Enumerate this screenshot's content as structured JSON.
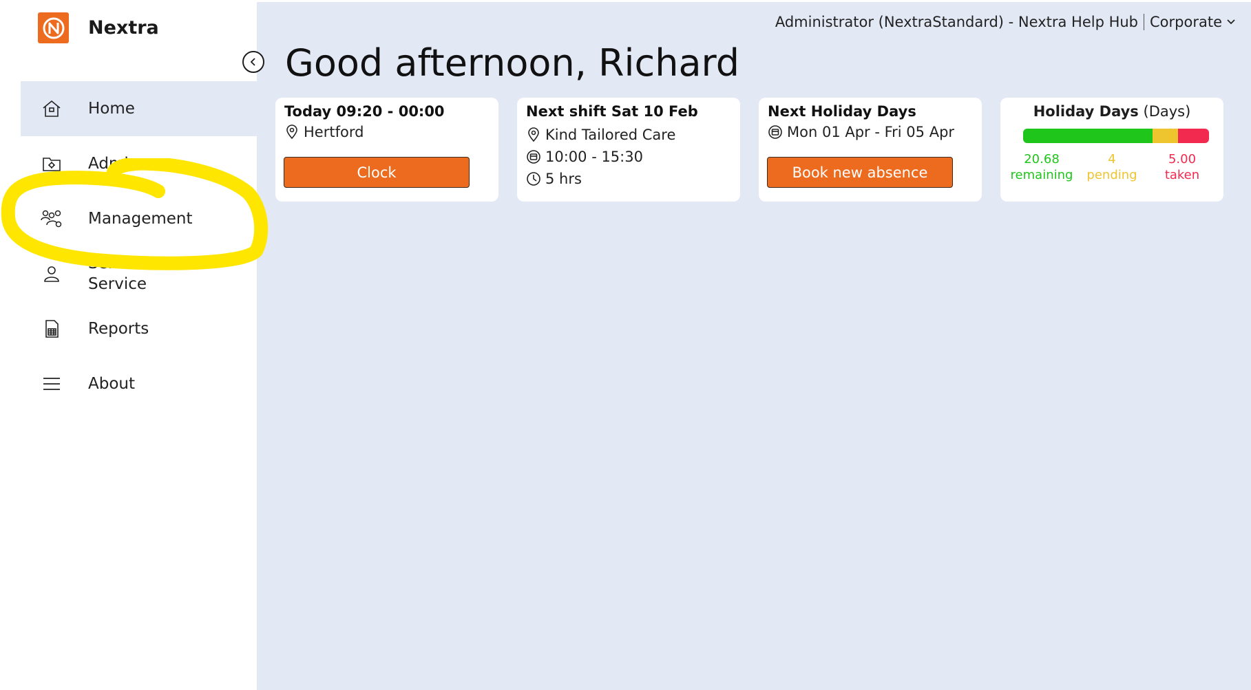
{
  "app": {
    "name": "Nextra",
    "logo_icon": "nextra-logo-icon",
    "brand_color": "#ec6b1e"
  },
  "header": {
    "user_info": "Administrator (NextraStandard) - Nextra Help Hub",
    "org": "Corporate"
  },
  "greeting": "Good afternoon, Richard",
  "sidebar": {
    "items": [
      {
        "label": "Home",
        "icon": "home-icon",
        "active": true
      },
      {
        "label": "Admin",
        "icon": "admin-folder-icon",
        "active": false
      },
      {
        "label": "Management",
        "icon": "management-people-icon",
        "active": false
      },
      {
        "label": "Self-\nService",
        "icon": "user-icon",
        "active": false
      },
      {
        "label": "Reports",
        "icon": "report-icon",
        "active": false
      },
      {
        "label": "About",
        "icon": "menu-icon",
        "active": false
      }
    ]
  },
  "cards": {
    "today": {
      "title": "Today 09:20 - 00:00",
      "location": "Hertford",
      "button": "Clock"
    },
    "next_shift": {
      "title": "Next shift Sat 10 Feb",
      "place": "Kind Tailored Care",
      "time": "10:00 - 15:30",
      "duration": "5 hrs"
    },
    "holiday_next": {
      "title": "Next Holiday Days",
      "dates": "Mon 01 Apr - Fri 05 Apr",
      "button": "Book new absence"
    },
    "holiday_days": {
      "title": "Holiday Days",
      "unit": "(Days)",
      "remaining_value": "20.68",
      "remaining_label": "remaining",
      "pending_value": "4",
      "pending_label": "pending",
      "taken_value": "5.00",
      "taken_label": "taken",
      "colors": {
        "remaining": "#20c51c",
        "pending": "#eec42f",
        "taken": "#f22a4f"
      }
    }
  }
}
